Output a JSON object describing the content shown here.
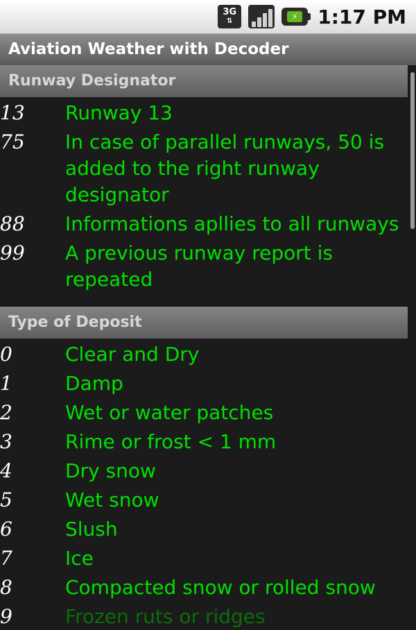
{
  "status_bar": {
    "network": "3G",
    "time": "1:17 PM"
  },
  "app": {
    "title": "Aviation Weather with Decoder"
  },
  "sections": [
    {
      "title": "Runway Designator",
      "rows": [
        {
          "code": "13",
          "desc": "Runway 13"
        },
        {
          "code": "75",
          "desc": "In case of parallel runways, 50 is added to the right runway designator"
        },
        {
          "code": "88",
          "desc": "Informations apllies to all runways"
        },
        {
          "code": "99",
          "desc": "A previous runway report is repeated"
        }
      ]
    },
    {
      "title": "Type of Deposit",
      "rows": [
        {
          "code": "0",
          "desc": "Clear and Dry"
        },
        {
          "code": "1",
          "desc": "Damp"
        },
        {
          "code": "2",
          "desc": "Wet or water patches"
        },
        {
          "code": "3",
          "desc": "Rime or frost < 1 mm"
        },
        {
          "code": "4",
          "desc": "Dry snow"
        },
        {
          "code": "5",
          "desc": "Wet snow"
        },
        {
          "code": "6",
          "desc": "Slush"
        },
        {
          "code": "7",
          "desc": "Ice"
        },
        {
          "code": "8",
          "desc": "Compacted snow or rolled snow"
        },
        {
          "code": "9",
          "desc": "Frozen ruts or ridges"
        }
      ]
    }
  ]
}
